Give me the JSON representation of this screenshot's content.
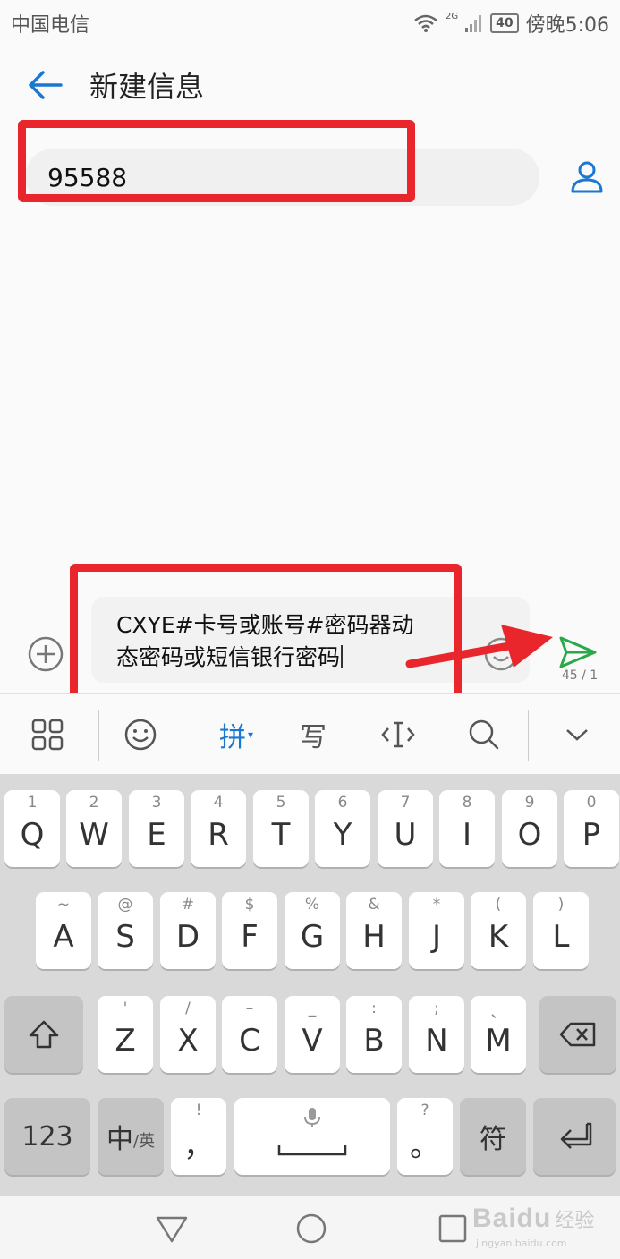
{
  "status_bar": {
    "carrier": "中国电信",
    "network": "2G",
    "battery": "40",
    "time": "傍晚5:06"
  },
  "header": {
    "title": "新建信息",
    "back_icon": "back-arrow-icon"
  },
  "recipient": {
    "value": "95588",
    "contact_icon": "person-icon"
  },
  "composer": {
    "message_line1": "CXYE#卡号或账号#密码器动",
    "message_line2": "态密码或短信银行密码",
    "char_count": "45 / 1",
    "add_icon": "plus-circle-icon",
    "emoji_icon": "emoji-icon",
    "send_icon": "send-icon"
  },
  "ime_toolbar": {
    "items": [
      {
        "name": "grid-icon",
        "label": ""
      },
      {
        "name": "smiley-icon",
        "label": ""
      },
      {
        "name": "pinyin-mode",
        "label": "拼"
      },
      {
        "name": "handwriting-icon",
        "label": "写"
      },
      {
        "name": "cursor-icon",
        "label": ""
      },
      {
        "name": "search-icon",
        "label": ""
      },
      {
        "name": "collapse-icon",
        "label": ""
      }
    ]
  },
  "keyboard": {
    "row1": [
      {
        "main": "Q",
        "sub": "1"
      },
      {
        "main": "W",
        "sub": "2"
      },
      {
        "main": "E",
        "sub": "3"
      },
      {
        "main": "R",
        "sub": "4"
      },
      {
        "main": "T",
        "sub": "5"
      },
      {
        "main": "Y",
        "sub": "6"
      },
      {
        "main": "U",
        "sub": "7"
      },
      {
        "main": "I",
        "sub": "8"
      },
      {
        "main": "O",
        "sub": "9"
      },
      {
        "main": "P",
        "sub": "0"
      }
    ],
    "row2": [
      {
        "main": "A",
        "sub": "~"
      },
      {
        "main": "S",
        "sub": "@"
      },
      {
        "main": "D",
        "sub": "#"
      },
      {
        "main": "F",
        "sub": "$"
      },
      {
        "main": "G",
        "sub": "%"
      },
      {
        "main": "H",
        "sub": "&"
      },
      {
        "main": "J",
        "sub": "*"
      },
      {
        "main": "K",
        "sub": "("
      },
      {
        "main": "L",
        "sub": ")"
      }
    ],
    "row3": [
      {
        "main": "Z",
        "sub": "'"
      },
      {
        "main": "X",
        "sub": "/"
      },
      {
        "main": "C",
        "sub": "–"
      },
      {
        "main": "V",
        "sub": "_"
      },
      {
        "main": "B",
        "sub": ":"
      },
      {
        "main": "N",
        "sub": ";"
      },
      {
        "main": "M",
        "sub": "、"
      }
    ],
    "bottom": {
      "numbers": "123",
      "lang_main": "中",
      "lang_sub": "/英",
      "comma_main": "，",
      "comma_sub": "!",
      "period_main": "。",
      "period_sub": "?",
      "symbols": "符"
    }
  },
  "watermark": {
    "brand": "Baidu",
    "cn": "经验",
    "url": "jingyan.baidu.com"
  },
  "colors": {
    "accent_blue": "#1a78d2",
    "send_green": "#2aa84a",
    "highlight_red": "#e8262c"
  }
}
